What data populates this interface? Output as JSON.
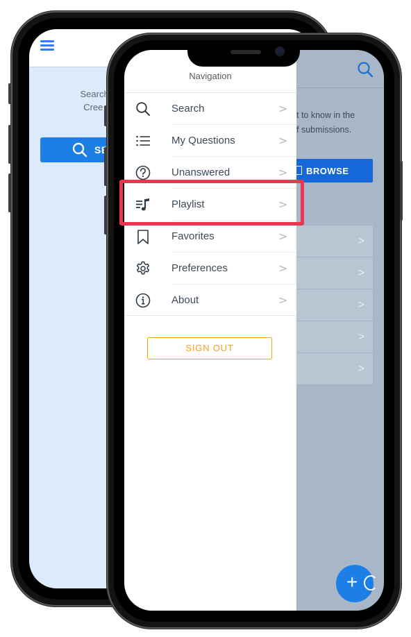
{
  "back_screen": {
    "text_line1": "Search for w",
    "text_line2": "Cree langu",
    "search_button_label": "SE"
  },
  "front_screen": {
    "behind_text_line1": "t to know in the",
    "behind_text_line2": "f submissions.",
    "browse_label": "BROWSE",
    "list_chevron": ">"
  },
  "drawer": {
    "title": "Navigation",
    "items": [
      {
        "label": "Search",
        "icon": "search-icon"
      },
      {
        "label": "My Questions",
        "icon": "list-icon"
      },
      {
        "label": "Unanswered",
        "icon": "question-circle-icon"
      },
      {
        "label": "Playlist",
        "icon": "playlist-icon"
      },
      {
        "label": "Favorites",
        "icon": "bookmark-icon"
      },
      {
        "label": "Preferences",
        "icon": "gear-icon"
      },
      {
        "label": "About",
        "icon": "info-icon"
      }
    ],
    "chevron": ">",
    "sign_out_label": "SIGN OUT"
  },
  "fab": {
    "plus": "+"
  },
  "colors": {
    "accent_blue": "#1d7fe6",
    "sign_out_orange": "#f2a21b",
    "highlight_red": "#e8374e"
  }
}
